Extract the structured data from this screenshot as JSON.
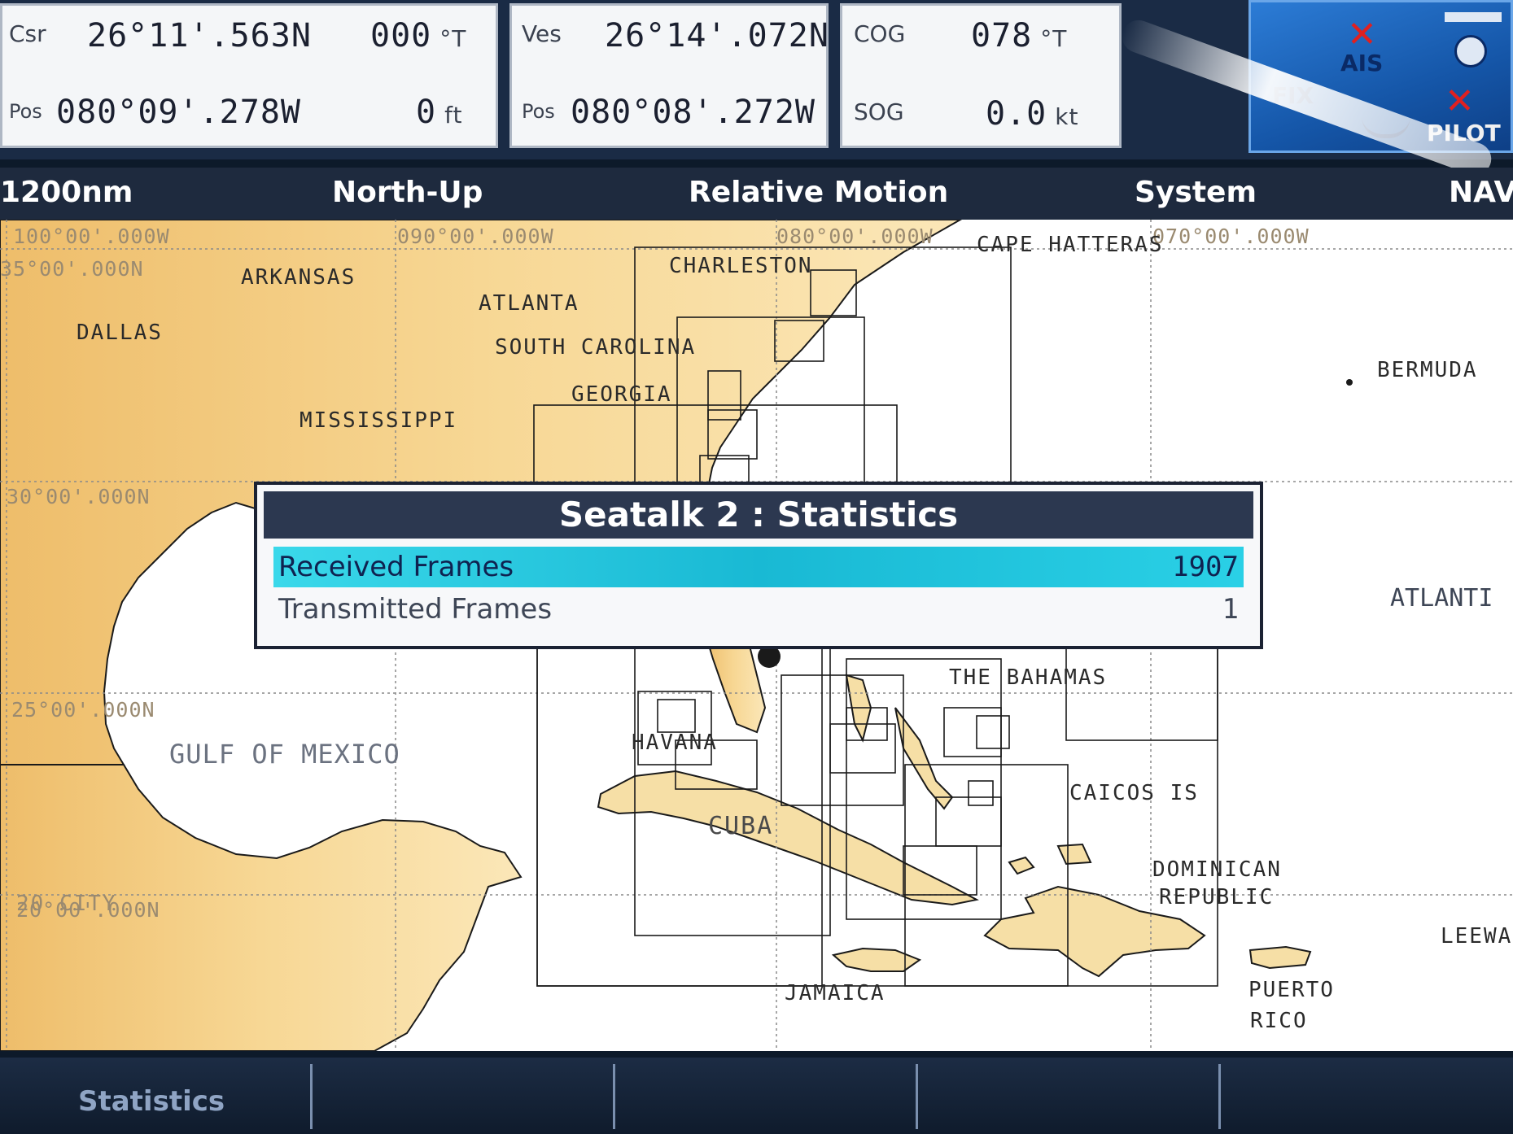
{
  "data_panels": {
    "cursor": {
      "label": "Csr",
      "lat": "26°11'.563N",
      "bearing": "000",
      "bearing_unit": "°T",
      "pos_label": "Pos",
      "lon": "080°09'.278W",
      "range": "0",
      "range_unit": "ft"
    },
    "vessel": {
      "label": "Ves",
      "lat": "26°14'.072N",
      "pos_label": "Pos",
      "lon": "080°08'.272W"
    },
    "course": {
      "cog_label": "COG",
      "cog_value": "078",
      "cog_unit": "°T",
      "sog_label": "SOG",
      "sog_value": "0.0",
      "sog_unit": "kt"
    }
  },
  "status_box": {
    "ais_label": "AIS",
    "fix_label": "FIX",
    "pilot_label": "PILOT"
  },
  "menu": {
    "range": "1200nm",
    "orientation": "North-Up",
    "motion": "Relative Motion",
    "system": "System",
    "nav": "NAV"
  },
  "chart": {
    "coordinates": {
      "lon_100": "100°00'.000W",
      "lon_090": "090°00'.000W",
      "lon_080": "080°00'.000W",
      "lon_070": "070°00'.000W",
      "lat_35": "35°00'.000N",
      "lat_30": "30°00'.000N",
      "lat_25": "25°00'.000N",
      "lat_20": "20°00'.000N"
    },
    "places": {
      "arkansas": "ARKANSAS",
      "dallas": "DALLAS",
      "atlanta": "ATLANTA",
      "south_carolina": "SOUTH CAROLINA",
      "georgia": "GEORGIA",
      "mississippi": "MISSISSIPPI",
      "charleston": "CHARLESTON",
      "cape_hatteras": "CAPE HATTERAS",
      "bermuda": "BERMUDA",
      "atlantic": "ATLANTI",
      "gulf": "GULF OF MEXICO",
      "bahamas": "THE BAHAMAS",
      "havana": "HAVANA",
      "cuba": "CUBA",
      "caicos": "CAICOS IS",
      "dominican": "DOMINICAN",
      "republic": "REPUBLIC",
      "leeward": "LEEWA",
      "jamaica": "JAMAICA",
      "puerto": "PUERTO",
      "rico": "RICO",
      "mexico_city": "20 CITY"
    }
  },
  "dialog": {
    "title": "Seatalk 2 : Statistics",
    "rows": [
      {
        "label": "Received Frames",
        "value": "1907"
      },
      {
        "label": "Transmitted Frames",
        "value": "1"
      }
    ]
  },
  "softkeys": {
    "statistics": "Statistics"
  },
  "colors": {
    "land": "#f2c97a",
    "land_light": "#fbe3a8",
    "sea": "#ffffff",
    "highlight": "#1fc3db",
    "title_bar": "#2c3850"
  }
}
